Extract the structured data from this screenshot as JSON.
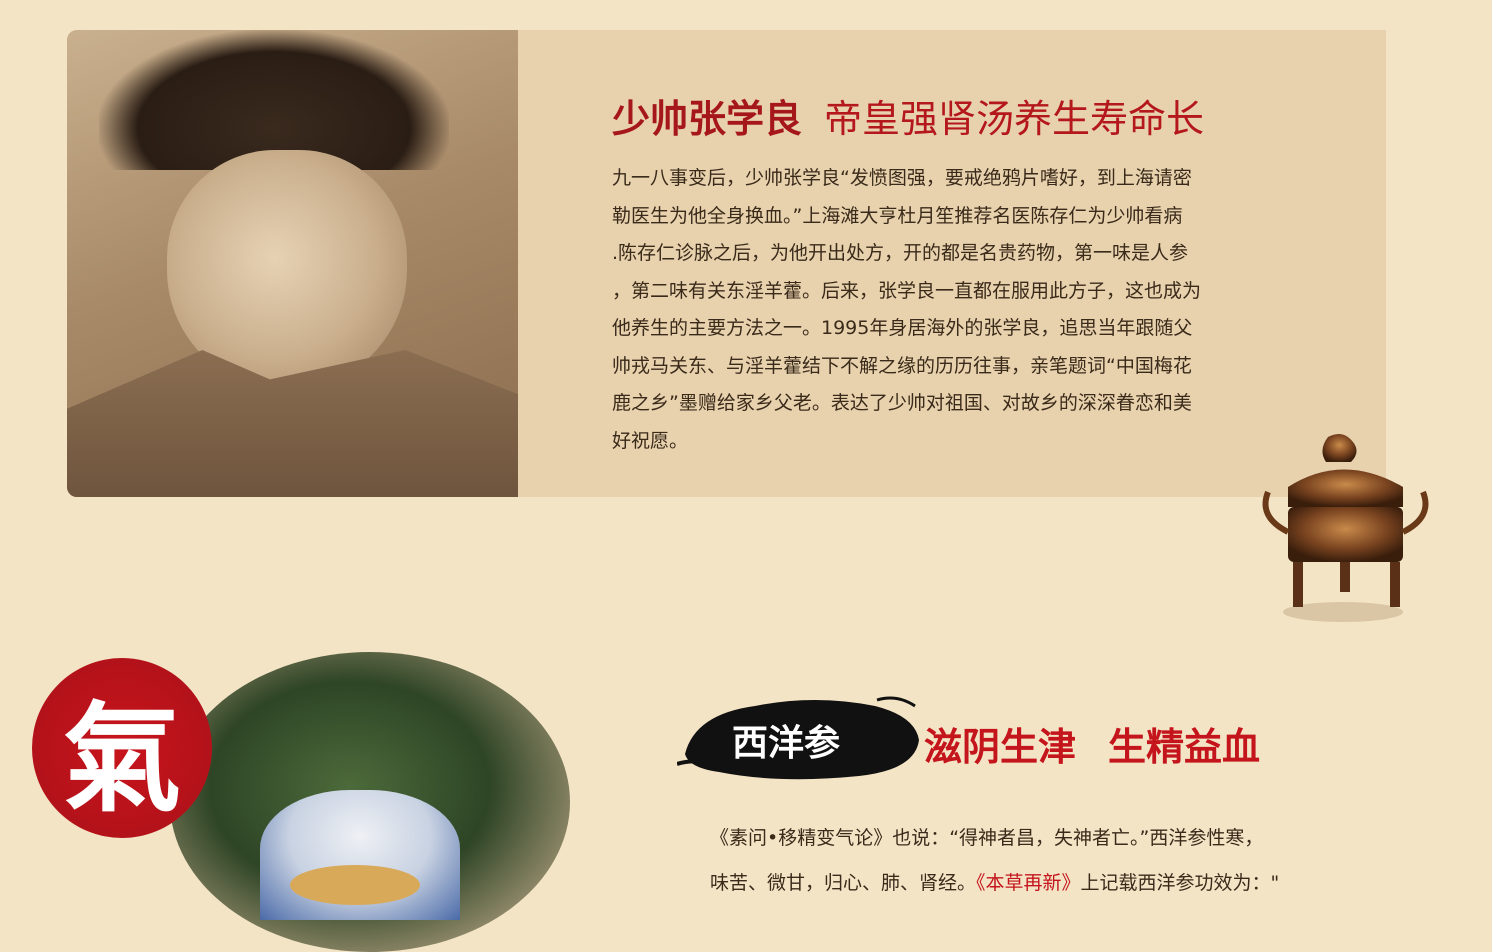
{
  "section1": {
    "title_main": "少帅张学良",
    "title_sub": "帝皇强肾汤养生寿命长",
    "paragraph_lines": [
      "九一八事变后，少帅张学良“发愤图强，要戒绝鸦片嗜好，到上海请密",
      "勒医生为他全身换血。”上海滩大亨杜月笙推荐名医陈存仁为少帅看病",
      ".陈存仁诊脉之后，为他开出处方，开的都是名贵药物，第一味是人参",
      "，第二味有关东淫羊藿。后来，张学良一直都在服用此方子，这也成为",
      "他养生的主要方法之一。1995年身居海外的张学良，追思当年跟随父",
      "帅戎马关东、与淫羊藿结下不解之缘的历历往事，亲笔题词“中国梅花",
      "鹿之乡”墨赠给家乡父老。表达了少帅对祖国、对故乡的深深眷恋和美",
      "好祝愿。"
    ]
  },
  "section2": {
    "seal_char": "氣",
    "brush_label": "西洋参",
    "title_part1": "滋阴生津",
    "title_part2": "生精益血",
    "line1": "《素问•移精变气论》也说：“得神者昌，失神者亡。”西洋参性寒，",
    "line2_pre": "味苦、微甘，归心、肺、肾经。",
    "line2_red": "《本草再新》",
    "line2_post": "上记载西洋参功效为：\""
  },
  "colors": {
    "background": "#f4e4c6",
    "card": "#e8d2ae",
    "title_red": "#a5171b",
    "seal_red": "#c8141c"
  }
}
